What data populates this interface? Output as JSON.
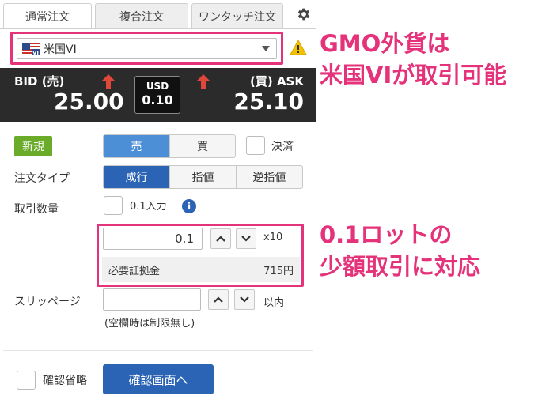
{
  "tabs": [
    {
      "label": "通常注文",
      "active": true
    },
    {
      "label": "複合注文",
      "active": false
    },
    {
      "label": "ワンタッチ注文",
      "active": false
    }
  ],
  "symbol": {
    "label": "米国VI"
  },
  "price": {
    "bid_label": "BID (売)",
    "ask_label": "(買) ASK",
    "bid": "25.00",
    "ask": "25.10",
    "spread_currency": "USD",
    "spread_value": "0.10"
  },
  "form": {
    "new_badge": "新規",
    "side": {
      "sell": "売",
      "buy": "買",
      "selected": "sell"
    },
    "settle_label": "決済",
    "order_type_label": "注文タイプ",
    "order_types": [
      "成行",
      "指値",
      "逆指値"
    ],
    "order_type_selected": "成行",
    "qty_label": "取引数量",
    "qty_decimal_label": "0.1入力",
    "qty_value": "0.1",
    "qty_unit": "x10",
    "margin_label": "必要証拠金",
    "margin_value": "715円",
    "slippage_label": "スリッページ",
    "slippage_value": "",
    "slippage_unit": "以内",
    "slippage_note": "(空欄時は制限無し)",
    "skip_confirm_label": "確認省略",
    "confirm_button": "確認画面へ"
  },
  "annotations": {
    "top_line1": "GMO外貨は",
    "top_line2": "米国VIが取引可能",
    "bottom_line1": "0.1ロットの",
    "bottom_line2": "少額取引に対応"
  },
  "colors": {
    "highlight": "#e4337a",
    "accent_blue": "#2b64b4",
    "sell_blue": "#4c8fd6",
    "new_green": "#6aab2a",
    "up_arrow_red": "#e0473b",
    "price_bar": "#2b2b2b"
  }
}
